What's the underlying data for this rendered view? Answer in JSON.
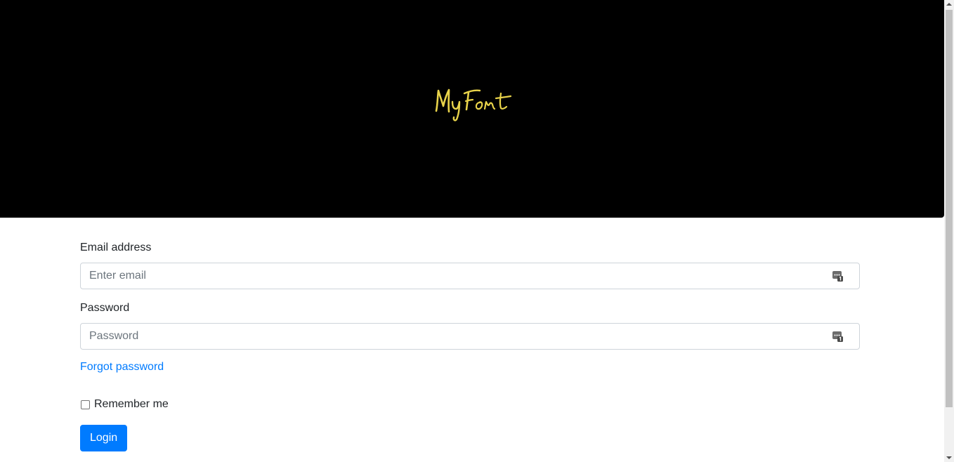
{
  "header": {
    "logo_text": "MyFont",
    "logo_color": "#e8d34a",
    "background_color": "#000000"
  },
  "form": {
    "email": {
      "label": "Email address",
      "placeholder": "Enter email",
      "value": "",
      "icon": "password-manager-icon"
    },
    "password": {
      "label": "Password",
      "placeholder": "Password",
      "value": "",
      "icon": "password-manager-icon"
    },
    "forgot_link": "Forgot password",
    "remember_me": {
      "label": "Remember me",
      "checked": false
    },
    "login_button": "Login"
  },
  "colors": {
    "primary": "#007bff",
    "link": "#007bff",
    "border": "#ced4da"
  }
}
